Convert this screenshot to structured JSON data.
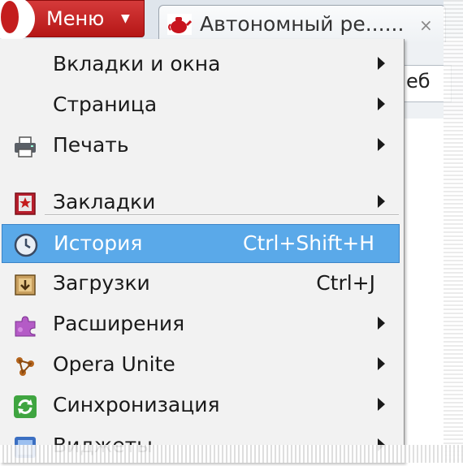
{
  "header": {
    "menu_label": "Меню",
    "tab_title": "Автономный ре......",
    "tab_close": "×",
    "address_fragment": "еб"
  },
  "menu": {
    "items": [
      {
        "label": "Вкладки и окна",
        "shortcut": "",
        "submenu": true,
        "icon": "none"
      },
      {
        "label": "Страница",
        "shortcut": "",
        "submenu": true,
        "icon": "none"
      },
      {
        "label": "Печать",
        "shortcut": "",
        "submenu": true,
        "icon": "printer-icon"
      },
      {
        "label": "Закладки",
        "shortcut": "",
        "submenu": true,
        "icon": "bookmarks-icon"
      },
      {
        "label": "История",
        "shortcut": "Ctrl+Shift+H",
        "submenu": false,
        "icon": "clock-icon",
        "highlighted": true
      },
      {
        "label": "Загрузки",
        "shortcut": "Ctrl+J",
        "submenu": false,
        "icon": "downloads-icon"
      },
      {
        "label": "Расширения",
        "shortcut": "",
        "submenu": true,
        "icon": "puzzle-icon"
      },
      {
        "label": "Opera Unite",
        "shortcut": "",
        "submenu": true,
        "icon": "unite-icon"
      },
      {
        "label": "Синхронизация",
        "shortcut": "",
        "submenu": true,
        "icon": "sync-icon"
      },
      {
        "label": "Виджеты",
        "shortcut": "",
        "submenu": true,
        "icon": "widgets-icon"
      }
    ]
  },
  "colors": {
    "menu_button": "#c41d1d",
    "highlight": "#5aa9e9",
    "menu_background": "#f2f2f2"
  }
}
